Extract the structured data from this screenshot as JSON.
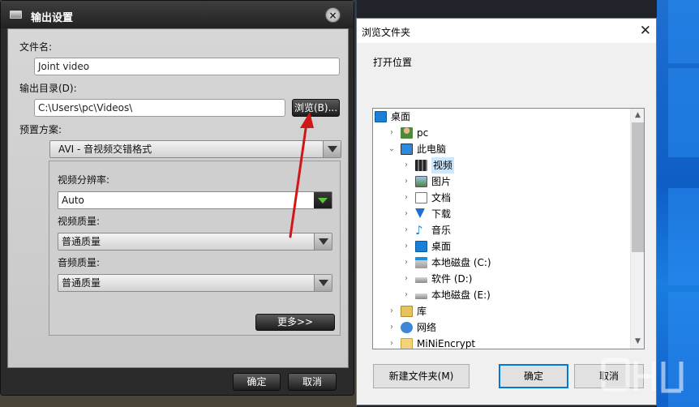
{
  "output_dialog": {
    "title": "输出设置",
    "close_glyph": "×",
    "filename_label": "文件名:",
    "filename_value": "Joint video",
    "output_dir_label": "输出目录(D):",
    "output_dir_value": "C:\\Users\\pc\\Videos\\",
    "browse_label": "浏览(B)...",
    "preset_label": "预置方案:",
    "preset_value": "AVI - 音视频交错格式",
    "resolution_label": "视频分辨率:",
    "resolution_value": "Auto",
    "video_quality_label": "视频质量:",
    "video_quality_value": "普通质量",
    "audio_quality_label": "音频质量:",
    "audio_quality_value": "普通质量",
    "more_label": "更多>>",
    "ok_label": "确定",
    "cancel_label": "取消"
  },
  "browse_dialog": {
    "title": "浏览文件夹",
    "close_glyph": "✕",
    "hint": "打开位置",
    "tree": [
      {
        "label": "桌面",
        "icon": "desktop-icon",
        "expander": "",
        "level": 0
      },
      {
        "label": "pc",
        "icon": "user-icon",
        "expander": "›",
        "level": 1
      },
      {
        "label": "此电脑",
        "icon": "computer-icon",
        "expander": "⌄",
        "level": 1
      },
      {
        "label": "视频",
        "icon": "video-folder-icon",
        "expander": "›",
        "level": 2,
        "selected": true
      },
      {
        "label": "图片",
        "icon": "pictures-folder-icon",
        "expander": "›",
        "level": 2
      },
      {
        "label": "文档",
        "icon": "documents-folder-icon",
        "expander": "›",
        "level": 2
      },
      {
        "label": "下载",
        "icon": "download-icon",
        "expander": "›",
        "level": 2
      },
      {
        "label": "音乐",
        "icon": "music-icon",
        "expander": "›",
        "level": 2
      },
      {
        "label": "桌面",
        "icon": "desktop-icon",
        "expander": "›",
        "level": 2
      },
      {
        "label": "本地磁盘 (C:)",
        "icon": "windows-drive-icon",
        "expander": "›",
        "level": 2
      },
      {
        "label": "软件 (D:)",
        "icon": "drive-icon",
        "expander": "›",
        "level": 2
      },
      {
        "label": "本地磁盘 (E:)",
        "icon": "drive-icon",
        "expander": "›",
        "level": 2
      },
      {
        "label": "库",
        "icon": "library-icon",
        "expander": "›",
        "level": 1
      },
      {
        "label": "网络",
        "icon": "network-icon",
        "expander": "›",
        "level": 1
      },
      {
        "label": "MiNiEncrypt",
        "icon": "folder-icon",
        "expander": "›",
        "level": 1
      }
    ],
    "new_folder_label": "新建文件夹(M)",
    "ok_label": "确定",
    "cancel_label": "取消",
    "scroll_up_glyph": "▲",
    "scroll_down_glyph": "▼"
  },
  "colors": {
    "annotation_arrow": "#d01818",
    "selection": "#cce8ff",
    "accent": "#0078d7"
  }
}
